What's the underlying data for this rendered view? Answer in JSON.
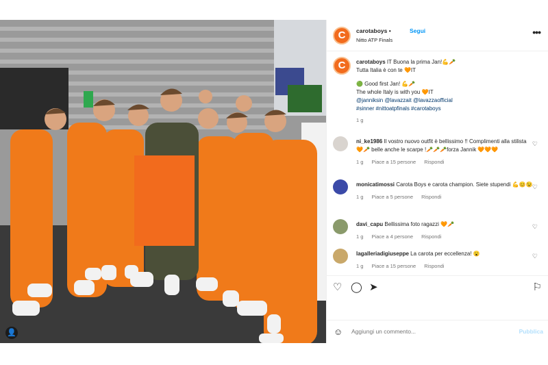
{
  "post": {
    "username": "carotaboys",
    "dot": "•",
    "follow_label": "Segui",
    "location": "Nitto ATP Finals",
    "avatar_letter": "C",
    "more_icon": "more-dots-icon"
  },
  "caption": {
    "username": "carotaboys",
    "line1": "IT Buona la prima Jan!💪🥕",
    "line2": "Tutta Italia è con te 🧡IT",
    "line3": "🟢 Good first Jan! 💪🥕",
    "line4": "The whole Italy is with you 🧡IT",
    "line5": "@janniksin @lavazzait @lavazzaofficial",
    "line6": "#sinner #nittoatpfinals #carotaboys",
    "time": "1 g"
  },
  "comments": [
    {
      "username": "ni_ke1986",
      "text": "Il vostro nuovo outfit è bellissimo !! Complimenti alla stilista 🧡🥕 belle anche le scarpe !🥕🥕🥕forza Jannik 🧡🧡🧡",
      "time": "1 g",
      "likes": "Piace a 15 persone",
      "reply": "Rispondi",
      "avatar_color": "#d9d4cf"
    },
    {
      "username": "monicatimossi",
      "text": "Carota Boys e carota champion. Siete stupendi 💪😊😉",
      "time": "1 g",
      "likes": "Piace a 5 persone",
      "reply": "Rispondi",
      "avatar_color": "#3b4aa8"
    },
    {
      "username": "davi_capu",
      "text": "Bellissima foto ragazzi 🧡🥕",
      "time": "1 g",
      "likes": "Piace a 4 persone",
      "reply": "Rispondi",
      "avatar_color": "#8a9a6b"
    },
    {
      "username": "lagalleriadigiuseppe",
      "text": "La carota per eccellenza! 😮",
      "time": "1 g",
      "likes": "Piace a 15 persone",
      "reply": "Rispondi",
      "avatar_color": "#c9a86a"
    }
  ],
  "add_comment": {
    "placeholder": "Aggiungi un commento...",
    "publish_label": "Pubblica"
  },
  "colors": {
    "brand_orange": "#f26b1d",
    "link_blue": "#0095f6",
    "tag_blue": "#00376b"
  }
}
